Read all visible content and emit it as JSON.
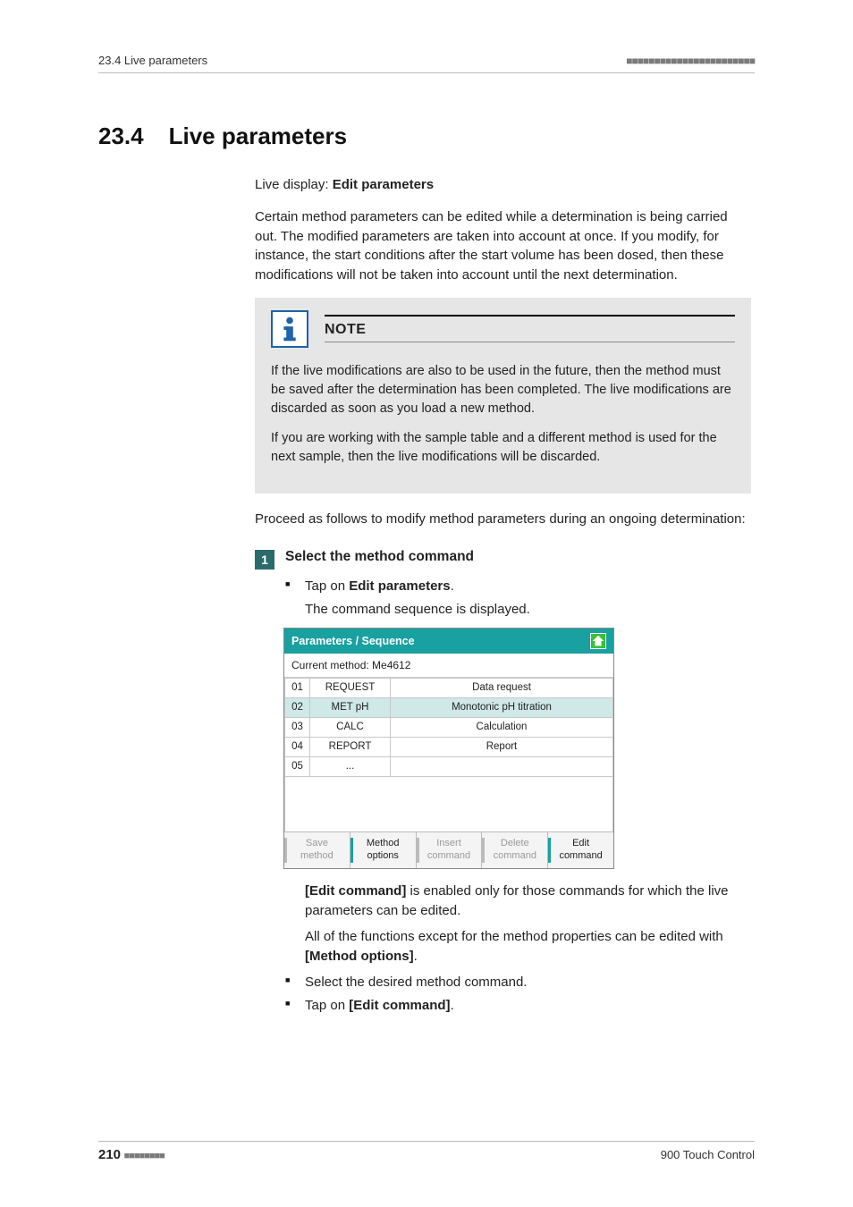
{
  "header": {
    "left": "23.4 Live parameters",
    "dashes": "■■■■■■■■■■■■■■■■■■■■■■■"
  },
  "section": {
    "number": "23.4",
    "title": "Live parameters"
  },
  "live_display_label": "Live display: ",
  "live_display_bold": "Edit parameters",
  "intro_para": "Certain method parameters can be edited while a determination is being carried out. The modified parameters are taken into account at once. If you modify, for instance, the start conditions after the start volume has been dosed, then these modifications will not be taken into account until the next determination.",
  "note": {
    "title": "NOTE",
    "p1": "If the live modifications are also to be used in the future, then the method must be saved after the determination has been completed. The live modifications are discarded as soon as you load a new method.",
    "p2": "If you are working with the sample table and a different method is used for the next sample, then the live modifications will be discarded."
  },
  "proceed_para": "Proceed as follows to modify method parameters during an ongoing determination:",
  "step": {
    "num": "1",
    "title": "Select the method command",
    "b1_pre": "Tap on ",
    "b1_bold": "Edit parameters",
    "b1_post": ".",
    "b1_sub": "The command sequence is displayed."
  },
  "ui": {
    "title": "Parameters / Sequence",
    "current": "Current method: Me4612",
    "rows": [
      {
        "idx": "01",
        "cmd": "REQUEST",
        "desc": "Data request",
        "sel": false
      },
      {
        "idx": "02",
        "cmd": "MET pH",
        "desc": "Monotonic pH titration",
        "sel": true
      },
      {
        "idx": "03",
        "cmd": "CALC",
        "desc": "Calculation",
        "sel": false
      },
      {
        "idx": "04",
        "cmd": "REPORT",
        "desc": "Report",
        "sel": false
      },
      {
        "idx": "05",
        "cmd": "...",
        "desc": "",
        "sel": false
      }
    ],
    "buttons": [
      {
        "l1": "Save",
        "l2": "method",
        "enabled": false
      },
      {
        "l1": "Method",
        "l2": "options",
        "enabled": true
      },
      {
        "l1": "Insert",
        "l2": "command",
        "enabled": false
      },
      {
        "l1": "Delete",
        "l2": "command",
        "enabled": false
      },
      {
        "l1": "Edit",
        "l2": "command",
        "enabled": true
      }
    ]
  },
  "after": {
    "p1_bold": "[Edit command]",
    "p1_rest": " is enabled only for those commands for which the live parameters can be edited.",
    "p2_a": "All of the functions except for the method properties can be edited with ",
    "p2_bold": "[Method options]",
    "p2_b": ".",
    "b2": "Select the desired method command.",
    "b3_pre": "Tap on ",
    "b3_bold": "[Edit command]",
    "b3_post": "."
  },
  "footer": {
    "page": "210",
    "dashes": "■■■■■■■■",
    "product": "900 Touch Control"
  }
}
